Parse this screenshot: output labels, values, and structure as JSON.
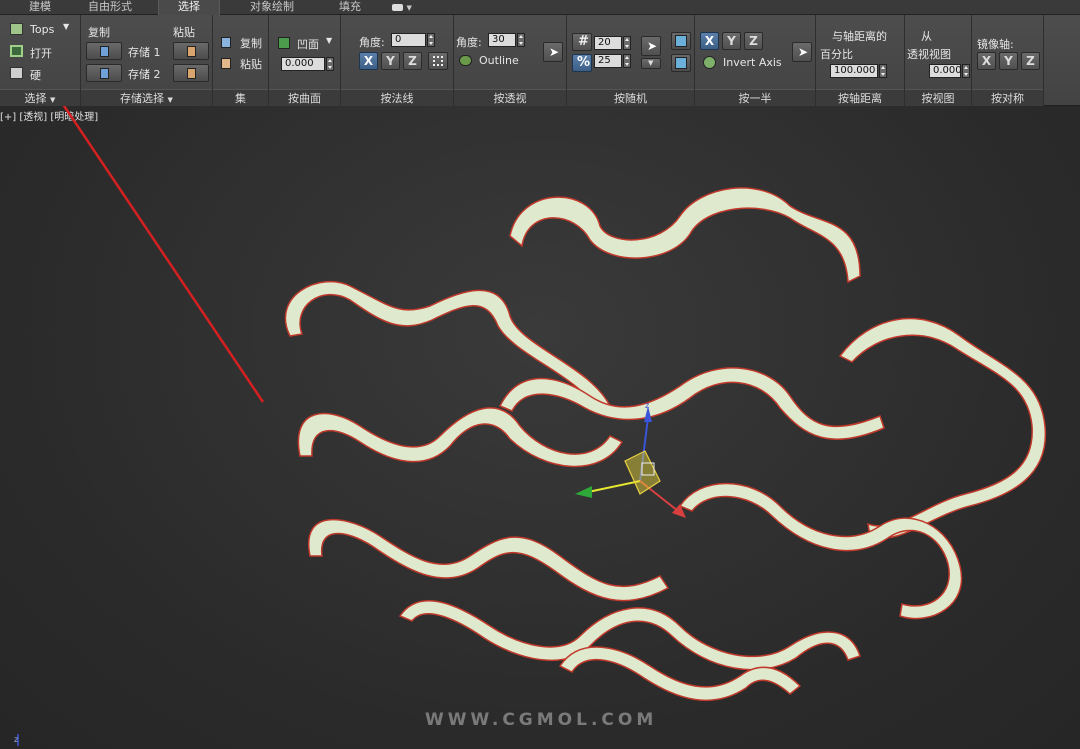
{
  "tabs": [
    "建模",
    "自由形式",
    "选择",
    "对象绘制",
    "填充"
  ],
  "ribbon": {
    "select": {
      "tops": "Tops",
      "open": "打开",
      "hard": "硬",
      "footer": "选择"
    },
    "store": {
      "copy": "复制",
      "paste": "粘贴",
      "store1": "存储 1",
      "store2": "存储 2",
      "footer": "存储选择"
    },
    "set": {
      "copy": "复制",
      "paste": "粘贴",
      "footer": "集"
    },
    "surface": {
      "mode": "凹面",
      "value": "0.000",
      "footer": "按曲面"
    },
    "normal": {
      "angle_label": "角度:",
      "angle_value": "0",
      "x": "X",
      "y": "Y",
      "z": "Z",
      "footer": "按法线"
    },
    "perspective": {
      "angle_label": "角度:",
      "angle_value": "30",
      "outline": "Outline",
      "footer": "按透视"
    },
    "random": {
      "v1": "20",
      "v2": "25",
      "footer": "按随机"
    },
    "half": {
      "x": "X",
      "y": "Y",
      "z": "Z",
      "invert": "Invert Axis",
      "footer": "按一半"
    },
    "axisdist": {
      "line1": "与轴距离的",
      "line2": "百分比",
      "value": "100.000",
      "footer": "按轴距离"
    },
    "view": {
      "line1": "从",
      "line2": "透视视图",
      "value": "0.000",
      "footer": "按视图"
    },
    "mirror": {
      "label": "镜像轴:",
      "x": "X",
      "y": "Y",
      "z": "Z",
      "footer": "按对称"
    }
  },
  "viewport": {
    "label": "[+] [透视] [明暗处理]",
    "watermark": "WWW.CGMOL.COM"
  },
  "colors": {
    "model_fill": "#dfe9cd",
    "model_edge": "#c0392b",
    "annotation_arrow": "#d42020"
  }
}
